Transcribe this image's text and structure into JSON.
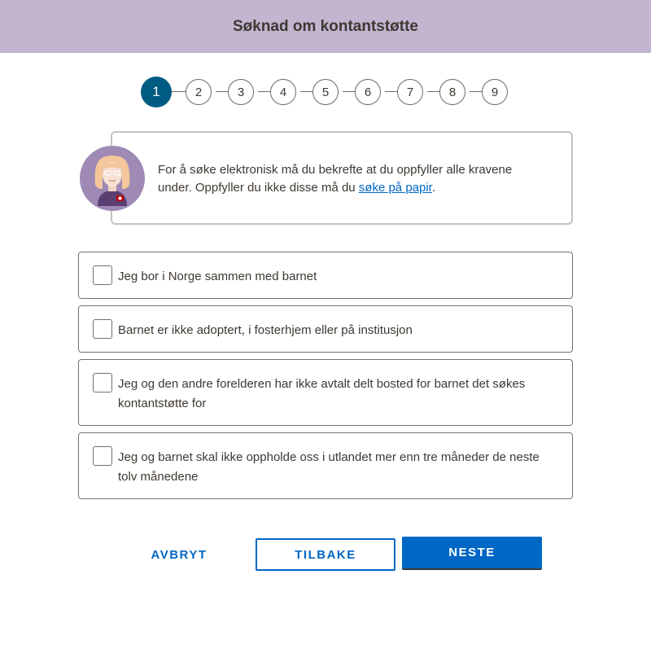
{
  "header": {
    "title": "Søknad om kontantstøtte"
  },
  "stepper": {
    "current": 1,
    "steps": [
      "1",
      "2",
      "3",
      "4",
      "5",
      "6",
      "7",
      "8",
      "9"
    ]
  },
  "intro": {
    "text_before_link": "For å søke elektronisk må du bekrefte at du oppfyller alle kravene under. Oppfyller du ikke disse må du ",
    "link_text": "søke på papir",
    "text_after_link": "."
  },
  "requirements": [
    {
      "label": "Jeg bor i Norge sammen med barnet",
      "checked": false
    },
    {
      "label": "Barnet er ikke adoptert, i fosterhjem eller på institusjon",
      "checked": false
    },
    {
      "label": "Jeg og den andre forelderen har ikke avtalt delt bosted for barnet det søkes kontantstøtte for",
      "checked": false
    },
    {
      "label": "Jeg og barnet skal ikke oppholde oss i utlandet mer enn tre måneder de neste tolv månedene",
      "checked": false
    }
  ],
  "actions": {
    "cancel_label": "AVBRYT",
    "back_label": "TILBAKE",
    "next_label": "NESTE"
  },
  "colors": {
    "header_bg": "#c1b5d0",
    "primary": "#0067c5",
    "step_active": "#005b82",
    "avatar_bg": "#9e8ab4",
    "text": "#3e3832"
  }
}
